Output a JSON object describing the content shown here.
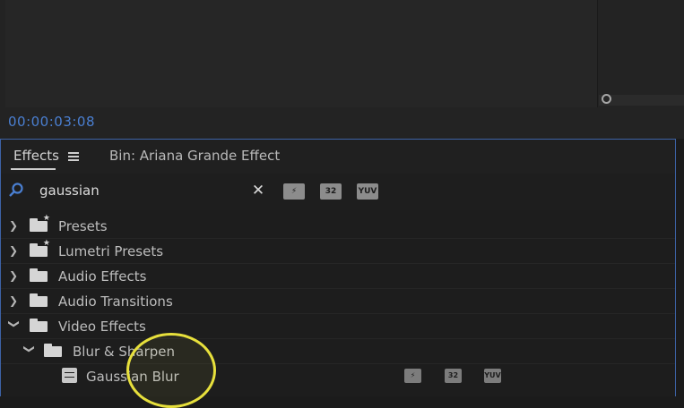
{
  "monitor": {
    "timecode": "00:00:03:08"
  },
  "panel": {
    "tabs": [
      {
        "label": "Effects"
      },
      {
        "label": "Bin: Ariana Grande Effect"
      }
    ]
  },
  "search": {
    "value": "gaussian"
  },
  "filters": [
    {
      "label": "⚡",
      "icon": "accelerated-effects-icon"
    },
    {
      "label": "32",
      "icon": "32-bit-color-icon"
    },
    {
      "label": "YUV",
      "icon": "yuv-icon"
    }
  ],
  "tree": {
    "items": [
      {
        "label": "Presets",
        "depth": 0,
        "expanded": false,
        "starred": true
      },
      {
        "label": "Lumetri Presets",
        "depth": 0,
        "expanded": false,
        "starred": true
      },
      {
        "label": "Audio Effects",
        "depth": 0,
        "expanded": false
      },
      {
        "label": "Audio Transitions",
        "depth": 0,
        "expanded": false
      },
      {
        "label": "Video Effects",
        "depth": 0,
        "expanded": true
      },
      {
        "label": "Blur & Sharpen",
        "depth": 1,
        "expanded": true
      },
      {
        "label": "Gaussian Blur",
        "depth": 2,
        "badges": [
          "⚡",
          "32",
          "YUV"
        ]
      }
    ]
  },
  "colors": {
    "timecode": "#4a7fd1",
    "panel_focus_border": "#3d62a6",
    "cursor_ring": "#e7e03c"
  }
}
